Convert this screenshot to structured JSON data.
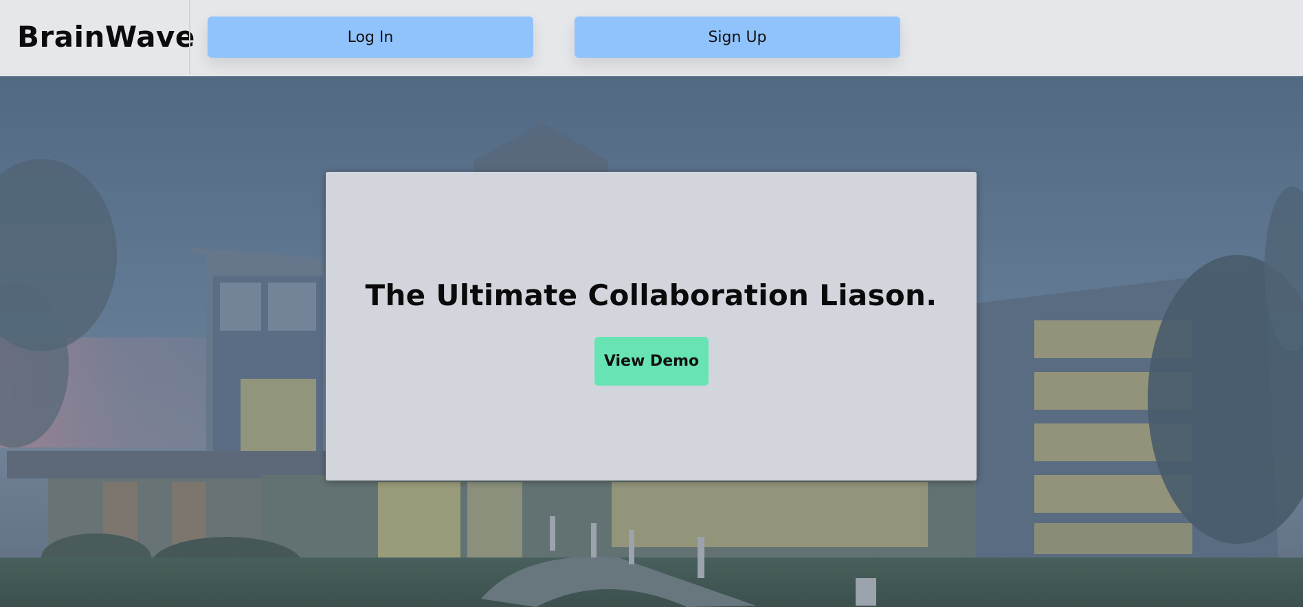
{
  "header": {
    "brand": "BrainWave",
    "login_label": "Log In",
    "signup_label": "Sign Up"
  },
  "hero": {
    "title": "The Ultimate Collaboration Liason.",
    "demo_label": "View Demo"
  },
  "colors": {
    "navbar_bg": "#e6e7ea",
    "nav_button": "#90c3fc",
    "card_bg": "#d3d5dd",
    "demo_button": "#68e4b4"
  }
}
